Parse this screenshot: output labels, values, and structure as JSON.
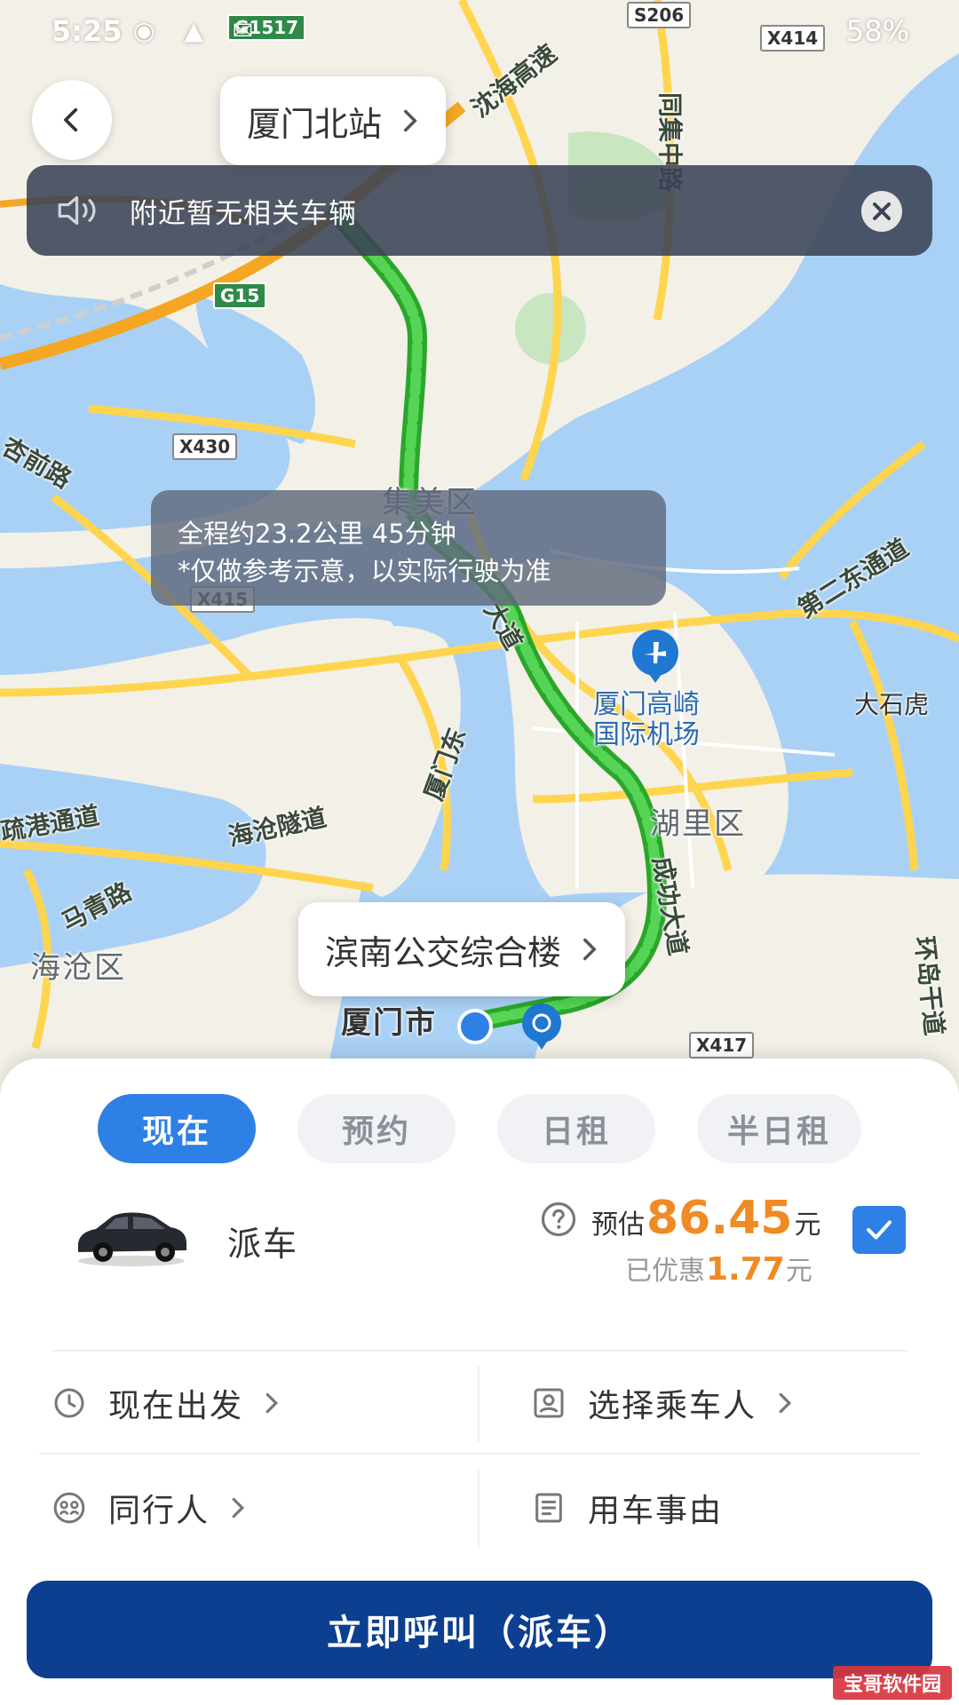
{
  "status_bar": {
    "time": "5:25",
    "battery": "58%"
  },
  "map": {
    "origin_name": "厦门北站",
    "destination_name": "滨南公交综合楼",
    "notice_text": "附近暂无相关车辆",
    "route_summary": "全程约23.2公里 45分钟",
    "route_disclaimer": "*仅做参考示意，以实际行驶为准",
    "labels": {
      "district_jimei": "集美区",
      "district_huli": "湖里区",
      "district_haicang": "海沧区",
      "city_xiamen": "厦门市",
      "airport": "厦门高崎",
      "airport2": "国际机场",
      "road_shenhai": "沈海高速",
      "road_tongji": "同集中路",
      "road_east2": "第二东通道",
      "road_haicang_tunnel": "海沧隧道",
      "road_shugang": "疏港通道",
      "road_maqing": "马青路",
      "road_chenggong": "成功大道",
      "road_xiamen_east": "厦门东",
      "road_xingqian": "杏前路",
      "road_huandao": "环岛干道",
      "place_dashihu": "大石虎",
      "road_avenue": "大道",
      "road_g15": "G15",
      "road_g1517": "G1517",
      "road_s206": "S206",
      "road_x414": "X414",
      "road_x430": "X430",
      "road_x415": "X415",
      "road_x417": "X417"
    }
  },
  "tabs": [
    {
      "label": "现在",
      "active": true
    },
    {
      "label": "预约",
      "active": false
    },
    {
      "label": "日租",
      "active": false
    },
    {
      "label": "半日租",
      "active": false
    }
  ],
  "car_option": {
    "name": "派车",
    "price_prefix": "预估",
    "price": "86.45",
    "price_unit": "元",
    "discount_prefix": "已优惠",
    "discount": "1.77",
    "discount_unit": "元",
    "selected": true
  },
  "options": {
    "depart_time": "现在出发",
    "passenger": "选择乘车人",
    "companion": "同行人",
    "reason": "用车事由"
  },
  "call_button": "立即呼叫（派车）",
  "watermark": "宝哥软件园",
  "colors": {
    "accent": "#2e80e6",
    "primary_button": "#0c3f8f",
    "price": "#f08a24",
    "route": "#3cc23c"
  }
}
